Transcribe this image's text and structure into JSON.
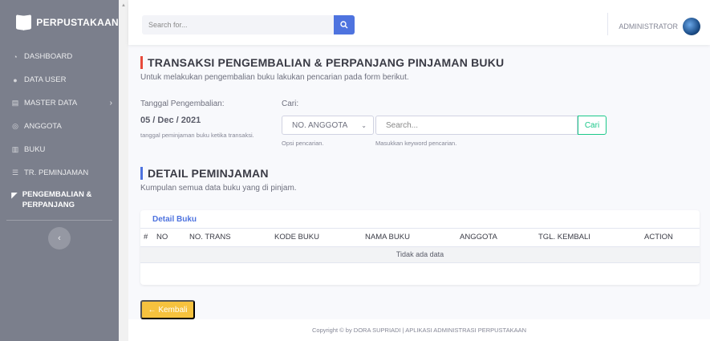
{
  "brand": {
    "name": "PERPUSTAKAAN"
  },
  "sidebar": {
    "items": [
      {
        "label": "DASHBOARD",
        "icon": "dashboard-icon"
      },
      {
        "label": "DATA USER",
        "icon": "users-icon"
      },
      {
        "label": "MASTER DATA",
        "icon": "database-icon",
        "chevron": "›"
      },
      {
        "label": "ANGGOTA",
        "icon": "members-icon"
      },
      {
        "label": "BUKU",
        "icon": "book-icon"
      },
      {
        "label": "TR. PEMINJAMAN",
        "icon": "list-icon"
      },
      {
        "label": "PENGEMBALIAN & PERPANJANG",
        "icon": "return-icon",
        "active": true
      }
    ],
    "toggle": "‹"
  },
  "topbar": {
    "search_placeholder": "Search for...",
    "user_name": "ADMINISTRATOR"
  },
  "main": {
    "title": "TRANSAKSI PENGEMBALIAN & PERPANJANG PINJAMAN BUKU",
    "subtitle": "Untuk melakukan pengembalian buku lakukan pencarian pada form berikut.",
    "date_label": "Tanggal Pengembalian:",
    "date_value": "05 / Dec / 2021",
    "date_hint": "tanggal peminjaman buku ketika transaksi.",
    "search_label": "Cari:",
    "select_value": "NO. ANGGOTA",
    "select_hint": "Opsi pencarian.",
    "keyword_placeholder": "Search...",
    "keyword_hint": "Masukkan keyword pencarian.",
    "search_button": "Cari",
    "detail_title": "DETAIL PEMINJAMAN",
    "detail_subtitle": "Kumpulan semua data buku yang di pinjam.",
    "card_title": "Detail Buku",
    "table": {
      "columns": [
        "#",
        "NO",
        "NO. TRANS",
        "KODE BUKU",
        "NAMA BUKU",
        "ANGGOTA",
        "TGL. KEMBALI",
        "ACTION"
      ],
      "empty_text": "Tidak ada data"
    },
    "back_button": "← Kembali"
  },
  "footer": {
    "text": "Copyright © by DORA SUPRIADI | APLIKASI ADMINISTRASI PERPUSTAKAAN"
  },
  "colors": {
    "sidebar": "#7b7f8c",
    "primary": "#4e73df",
    "danger": "#e74a3b",
    "success": "#1cc88a",
    "warning": "#f6c23e"
  }
}
